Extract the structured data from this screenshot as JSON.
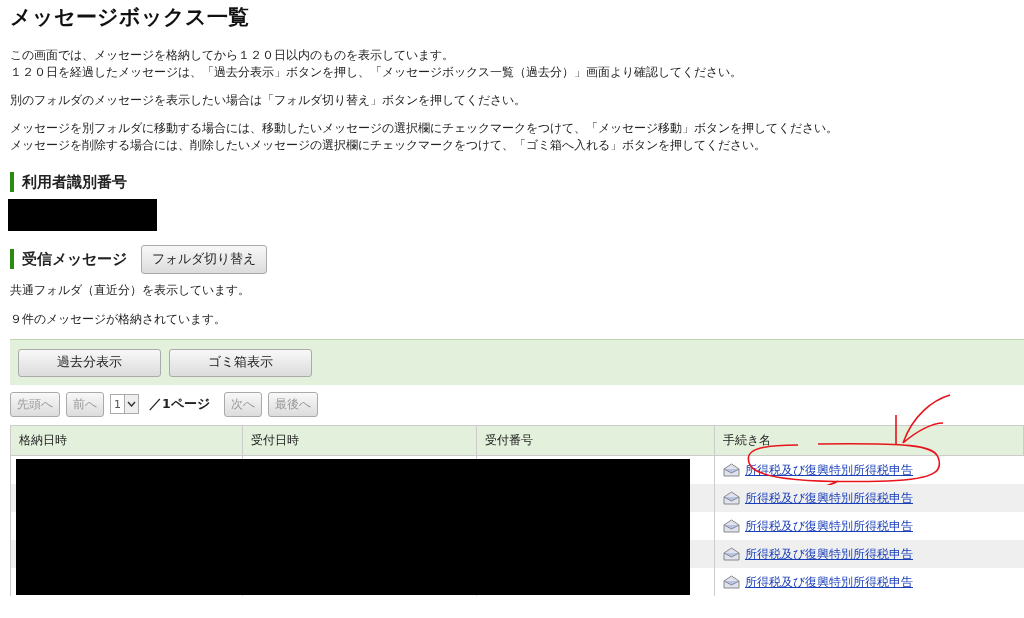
{
  "title": "メッセージボックス一覧",
  "intro": [
    [
      "この画面では、メッセージを格納してから１２０日以内のものを表示しています。",
      "１２０日を経過したメッセージは、「過去分表示」ボタンを押し、「メッセージボックス一覧（過去分）」画面より確認してください。"
    ],
    [
      "別のフォルダのメッセージを表示したい場合は「フォルダ切り替え」ボタンを押してください。"
    ],
    [
      "メッセージを別フォルダに移動する場合には、移動したいメッセージの選択欄にチェックマークをつけて、「メッセージ移動」ボタンを押してください。",
      "メッセージを削除する場合には、削除したいメッセージの選択欄にチェックマークをつけて、「ゴミ箱へ入れる」ボタンを押してください。"
    ]
  ],
  "user_id": {
    "heading": "利用者識別番号"
  },
  "inbox": {
    "heading": "受信メッセージ",
    "folder_button": "フォルダ切り替え",
    "folder_note": "共通フォルダ（直近分）を表示しています。",
    "count_note": "９件のメッセージが格納されています。"
  },
  "toolbar": [
    "過去分表示",
    "ゴミ箱表示"
  ],
  "pager": {
    "buttons_before": [
      {
        "label": "先頭へ",
        "disabled": true
      },
      {
        "label": "前へ",
        "disabled": true
      }
    ],
    "page_select": "1",
    "page_total": "／1ページ",
    "buttons_after": [
      {
        "label": "次へ",
        "disabled": true
      },
      {
        "label": "最後へ",
        "disabled": true
      }
    ]
  },
  "table": {
    "columns": [
      "格納日時",
      "受付日時",
      "受付番号",
      "手続き名"
    ],
    "rows": [
      {
        "procedure": "所得税及び復興特別所得税申告"
      },
      {
        "procedure": "所得税及び復興特別所得税申告"
      },
      {
        "procedure": "所得税及び復興特別所得税申告"
      },
      {
        "procedure": "所得税及び復興特別所得税申告"
      },
      {
        "procedure": "所得税及び復興特別所得税申告"
      }
    ]
  }
}
